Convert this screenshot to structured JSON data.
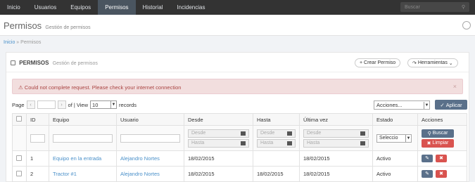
{
  "nav": {
    "items": [
      "Inicio",
      "Usuarios",
      "Equipos",
      "Permisos",
      "Historial",
      "Incidencias"
    ],
    "search_placeholder": "Buscar"
  },
  "page": {
    "title": "Permisos",
    "subtitle": "Gestión de permisos"
  },
  "breadcrumb": {
    "home": "Inicio",
    "separator": "»",
    "current": "Permisos"
  },
  "panel": {
    "title": "PERMISOS",
    "subtitle": "Gestión de permisos",
    "create_label": "+ Crear Permiso",
    "tools_label": "Herramientas"
  },
  "alert": {
    "message": "Could not complete request. Please check your internet connection",
    "close": "×"
  },
  "pager": {
    "page_label": "Page",
    "prev": "‹",
    "next": "›",
    "of_view": "of | View",
    "view_value": "10",
    "records_label": "records"
  },
  "actions": {
    "select_value": "Acciones...",
    "apply_label": "Aplicar"
  },
  "table": {
    "headers": [
      "ID",
      "Equipo",
      "Usuario",
      "Desde",
      "Hasta",
      "Última vez",
      "Estado",
      "Acciones"
    ],
    "filter": {
      "from_placeholder": "Desde",
      "to_placeholder": "Hasta",
      "estado_value": "Seleccio",
      "search_label": "Buscar",
      "clear_label": "Limpiar"
    },
    "rows": [
      {
        "id": "1",
        "equipo": "Equipo en la entrada",
        "usuario": "Alejandro Nortes",
        "desde": "18/02/2015",
        "hasta": "",
        "ultima": "18/02/2015",
        "estado": "Activo"
      },
      {
        "id": "2",
        "equipo": "Tractor #1",
        "usuario": "Alejandro Nortes",
        "desde": "18/02/2015",
        "hasta": "18/02/2015",
        "ultima": "18/02/2015",
        "estado": "Activo"
      }
    ]
  }
}
